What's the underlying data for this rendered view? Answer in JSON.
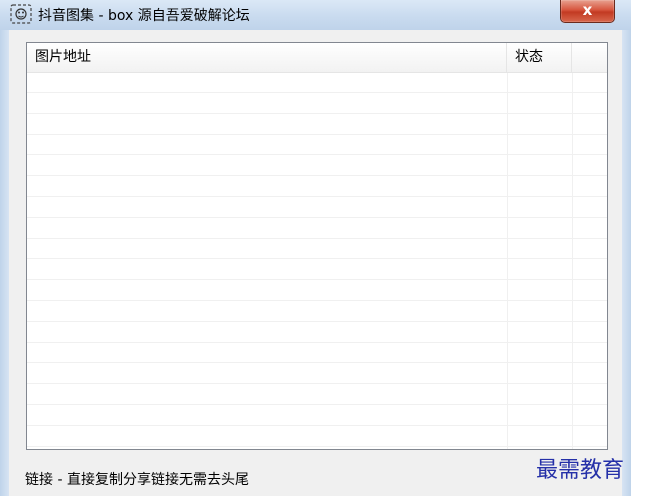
{
  "window": {
    "title": "抖音图集 - box   源自吾爱破解论坛",
    "close_label": "x"
  },
  "listview": {
    "columns": [
      {
        "label": "图片地址"
      },
      {
        "label": "状态"
      },
      {
        "label": ""
      }
    ],
    "row_count": 18
  },
  "statusbar": {
    "text": "链接 - 直接复制分享链接无需去头尾"
  },
  "watermark": {
    "text": "最需教育"
  },
  "colors": {
    "titlebar": "#c9dbef",
    "close_button": "#c23a22",
    "client_bg": "#f0f0f0",
    "watermark": "#2530a8"
  }
}
